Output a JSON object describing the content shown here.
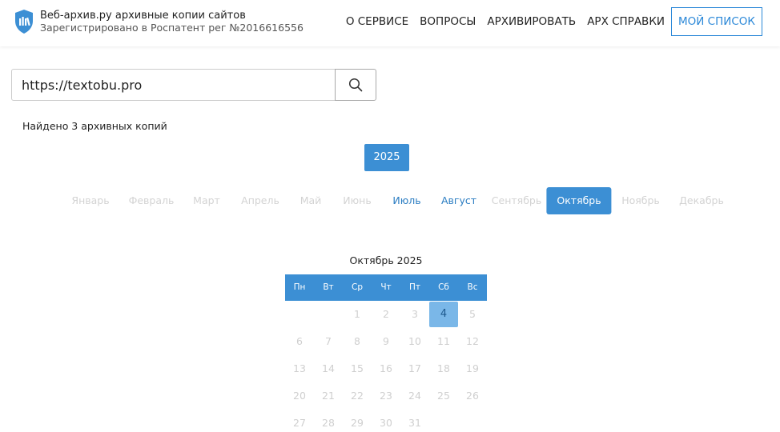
{
  "header": {
    "title": "Веб-архив.ру архивные копии сайтов",
    "subtitle": "Зарегистрировано в Роспатент рег №2016616556",
    "nav": {
      "about": "О СЕРВИСЕ",
      "faq": "ВОПРОСЫ",
      "archive": "АРХИВИРОВАТЬ",
      "certificates": "АРХ СПРАВКИ",
      "my_list": "МОЙ СПИСОК"
    },
    "accent_color": "#2b88d8"
  },
  "search": {
    "value": "https://textobu.pro",
    "button_icon": "search-icon"
  },
  "found_text": "Найдено 3 архивных копий",
  "year": "2025",
  "months": [
    {
      "label": "Январь",
      "state": "disabled"
    },
    {
      "label": "Февраль",
      "state": "disabled"
    },
    {
      "label": "Март",
      "state": "disabled"
    },
    {
      "label": "Апрель",
      "state": "disabled"
    },
    {
      "label": "Май",
      "state": "disabled"
    },
    {
      "label": "Июнь",
      "state": "disabled"
    },
    {
      "label": "Июль",
      "state": "active"
    },
    {
      "label": "Август",
      "state": "active"
    },
    {
      "label": "Сентябрь",
      "state": "disabled"
    },
    {
      "label": "Октябрь",
      "state": "selected"
    },
    {
      "label": "Ноябрь",
      "state": "disabled"
    },
    {
      "label": "Декабрь",
      "state": "disabled"
    }
  ],
  "calendar": {
    "title": "Октябрь 2025",
    "weekdays": [
      "Пн",
      "Вт",
      "Ср",
      "Чт",
      "Пт",
      "Сб",
      "Вс"
    ],
    "weeks": [
      [
        "",
        "",
        "1",
        "2",
        "3",
        "4",
        "5"
      ],
      [
        "6",
        "7",
        "8",
        "9",
        "10",
        "11",
        "12"
      ],
      [
        "13",
        "14",
        "15",
        "16",
        "17",
        "18",
        "19"
      ],
      [
        "20",
        "21",
        "22",
        "23",
        "24",
        "25",
        "26"
      ],
      [
        "27",
        "28",
        "29",
        "30",
        "31",
        "",
        ""
      ]
    ],
    "highlighted_days": [
      "4"
    ],
    "header_color": "#3c8fd4",
    "highlight_color": "#7ab7e8"
  }
}
